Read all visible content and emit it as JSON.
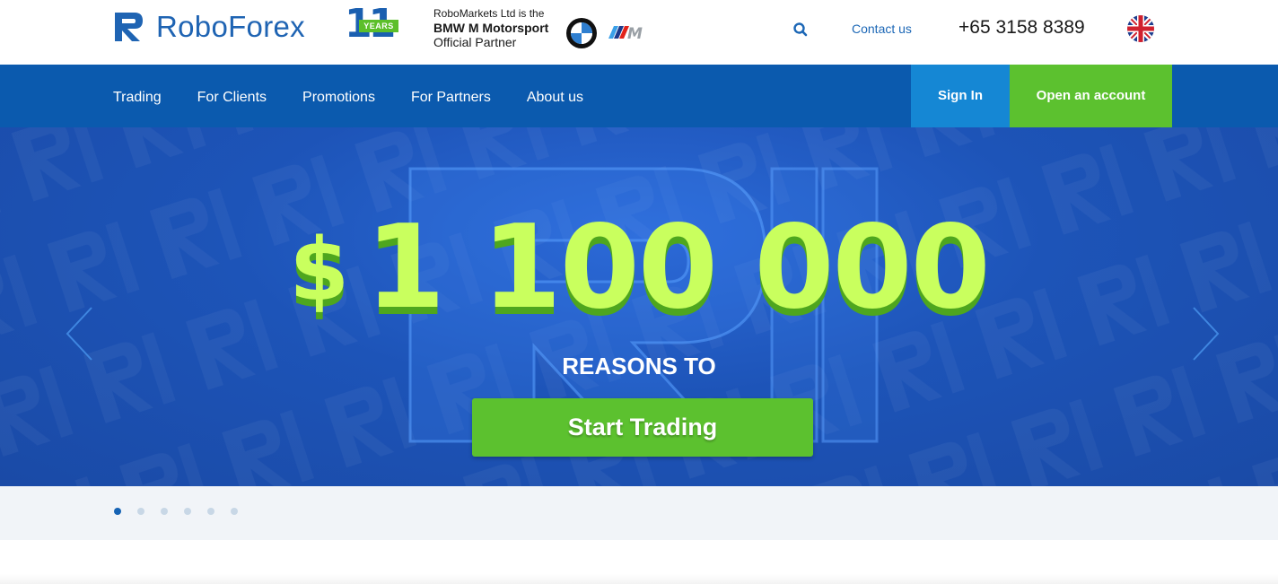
{
  "header": {
    "logo_text": "RoboForex",
    "years_number": "11",
    "years_label": "YEARS",
    "partner_line1": "RoboMarkets Ltd is the",
    "partner_line2": "BMW M Motorsport",
    "partner_line3": "Official Partner",
    "contact_label": "Contact us",
    "phone": "+65 3158 8389",
    "language_flag": "uk-flag-icon"
  },
  "nav": {
    "items": [
      {
        "label": "Trading"
      },
      {
        "label": "For Clients"
      },
      {
        "label": "Promotions"
      },
      {
        "label": "For Partners"
      },
      {
        "label": "About us"
      }
    ],
    "signin_label": "Sign In",
    "open_account_label": "Open an account"
  },
  "hero": {
    "currency": "$",
    "amount": "1 100 000",
    "subtitle": "REASONS TO",
    "cta_label": "Start Trading",
    "slides_total": 6,
    "active_slide": 1
  },
  "colors": {
    "brand_blue": "#0b5aae",
    "signin_blue": "#1587d4",
    "accent_green": "#5cc12f",
    "prize_green": "#c9ff5e"
  }
}
